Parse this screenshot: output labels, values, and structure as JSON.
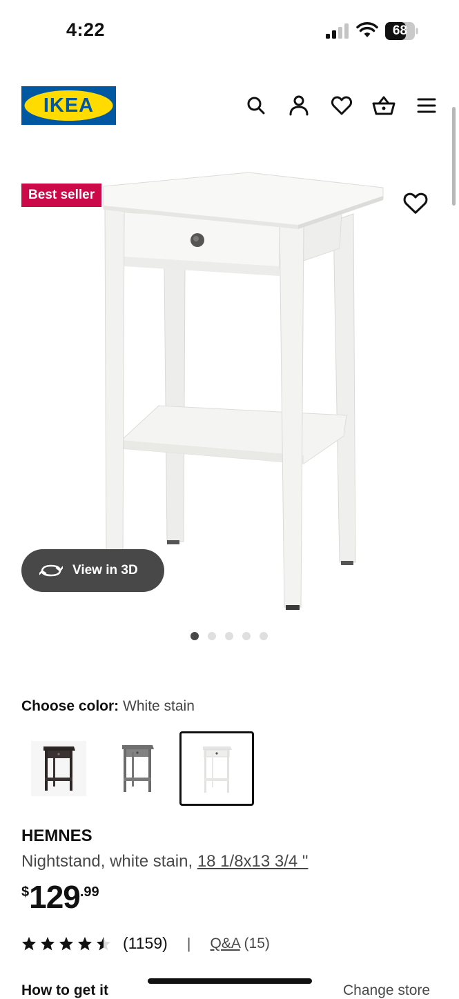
{
  "status_bar": {
    "time": "4:22",
    "battery": "68"
  },
  "header": {
    "logo_text": "IKEA",
    "icons": [
      "search-icon",
      "account-icon",
      "heart-icon",
      "cart-icon",
      "menu-icon"
    ]
  },
  "hero": {
    "badge": "Best seller",
    "view_3d_label": "View in 3D",
    "carousel_pages": 5,
    "carousel_active": 1
  },
  "color_chooser": {
    "label": "Choose color:",
    "selected_value": "White stain",
    "options": [
      "black-brown",
      "gray",
      "white stain"
    ],
    "selected_index": 2
  },
  "product": {
    "name": "HEMNES",
    "description": "Nightstand, white stain,",
    "dimensions": "18 1/8x13 3/4 \"",
    "price_currency": "$",
    "price_integer": "129",
    "price_decimals": ".99",
    "rating_stars": 4.5,
    "rating_count": "(1159)",
    "separator": "|",
    "qa_label": "Q&A",
    "qa_count": "(15)"
  },
  "footer": {
    "how_to_get_it": "How to get it",
    "change_store": "Change store"
  },
  "colors": {
    "badge_red": "#cc0a49",
    "ikea_blue": "#0058a3",
    "ikea_yellow": "#ffdb00",
    "pill_dark": "#484848"
  }
}
